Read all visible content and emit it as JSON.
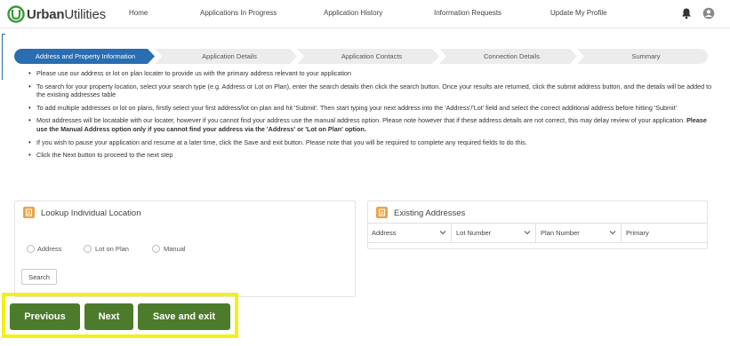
{
  "brand": {
    "name_prefix": "Urban",
    "name_suffix": "Utilities",
    "logo_color": "#3a9a3a"
  },
  "nav": {
    "items": [
      {
        "label": "Home"
      },
      {
        "label": "Applications In Progress"
      },
      {
        "label": "Application History"
      },
      {
        "label": "Information Requests"
      },
      {
        "label": "Update My Profile"
      }
    ],
    "icons": [
      "bell-icon",
      "user-account-icon"
    ]
  },
  "steps": {
    "items": [
      {
        "label": "Address and Property Information",
        "active": true
      },
      {
        "label": "Application Details",
        "active": false
      },
      {
        "label": "Application Contacts",
        "active": false
      },
      {
        "label": "Connection Details",
        "active": false
      },
      {
        "label": "Summary",
        "active": false
      }
    ],
    "active_color": "#2a6db0",
    "inactive_color": "#ececec"
  },
  "instructions": {
    "items": [
      {
        "text": "Please use our address or lot on plan locater to provide us with the primary address relevant to your application",
        "bold": ""
      },
      {
        "text": "To search for your property location, select your search type (e.g. Address or Lot on Plan), enter the search details then click the search button. Once your results are returned, click the submit address button, and the details will be added to the existing addresses table",
        "bold": ""
      },
      {
        "text": "To add multiple addresses or lot on plans, firstly select your first address/lot on plan and hit 'Submit'. Then start typing your next address into the 'Address'/'Lot' field and select the correct additional address before hitting 'Submit'",
        "bold": ""
      },
      {
        "text": "Most addresses will be locatable with our locater, however if you cannot find your address use the manual address option. Please note however that if these address details are not correct, this may delay review of your application. ",
        "bold": "Please use the Manual Address option only if you cannot find your address via the 'Address' or 'Lot on Plan' option."
      },
      {
        "text": "If you wish to pause your application and resume at a later time, click the Save and exit button. Please note that you will be required to complete any required fields to do this.",
        "bold": ""
      },
      {
        "text": "Click the Next button to proceed to the next step",
        "bold": ""
      }
    ]
  },
  "lookup_panel": {
    "title": "Lookup Individual Location",
    "icon": "building-icon",
    "options": [
      {
        "label": "Address"
      },
      {
        "label": "Lot on Plan"
      },
      {
        "label": "Manual"
      }
    ],
    "search_label": "Search"
  },
  "existing_panel": {
    "title": "Existing Addresses",
    "icon": "building-icon",
    "columns": [
      {
        "label": "Address"
      },
      {
        "label": "Lot Number"
      },
      {
        "label": "Plan Number"
      },
      {
        "label": "Primary"
      }
    ]
  },
  "actions": {
    "previous_label": "Previous",
    "next_label": "Next",
    "save_exit_label": "Save and exit",
    "button_color": "#4c7b2c",
    "highlight_color": "#f5ef18"
  }
}
